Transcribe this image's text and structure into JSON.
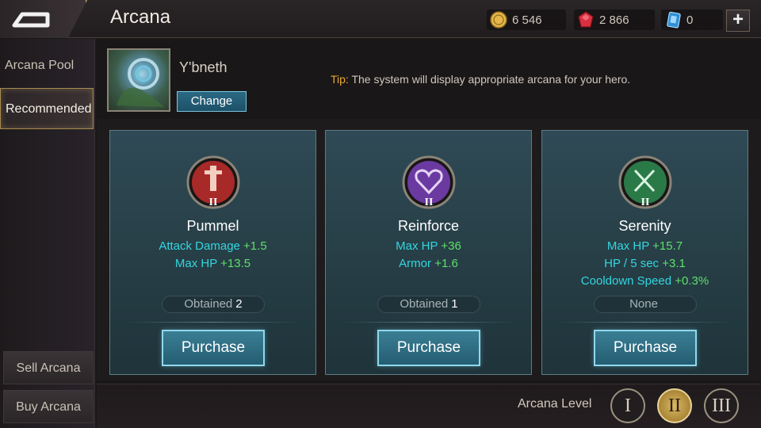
{
  "header": {
    "title": "Arcana",
    "resources": [
      {
        "icon": "gold-coin-icon",
        "value": "6 546"
      },
      {
        "icon": "ruby-gem-icon",
        "value": "2 866"
      },
      {
        "icon": "arcana-card-icon",
        "value": "0"
      }
    ],
    "plus_label": "+"
  },
  "sidebar": {
    "items": [
      {
        "label": "Arcana Pool"
      },
      {
        "label": "Recommended"
      }
    ],
    "sell_label": "Sell Arcana",
    "buy_label": "Buy Arcana"
  },
  "hero": {
    "name": "Y'bneth",
    "change_label": "Change",
    "tip_label": "Tip:",
    "tip_text": " The system will display appropriate arcana for your hero."
  },
  "cards": [
    {
      "name": "Pummel",
      "rank": "II",
      "color": "#b3322e",
      "stats": [
        {
          "label": "Attack Damage",
          "value": "+1.5"
        },
        {
          "label": "Max HP",
          "value": "+13.5"
        }
      ],
      "status_label": "Obtained",
      "status_count": "2",
      "purchase_label": "Purchase"
    },
    {
      "name": "Reinforce",
      "rank": "II",
      "color": "#7a3fb0",
      "stats": [
        {
          "label": "Max HP",
          "value": "+36"
        },
        {
          "label": "Armor",
          "value": "+1.6"
        }
      ],
      "status_label": "Obtained",
      "status_count": "1",
      "purchase_label": "Purchase"
    },
    {
      "name": "Serenity",
      "rank": "II",
      "color": "#2f8a52",
      "stats": [
        {
          "label": "Max HP",
          "value": "+15.7"
        },
        {
          "label": "HP / 5 sec",
          "value": "+3.1"
        },
        {
          "label": "Cooldown Speed",
          "value": "+0.3%"
        }
      ],
      "status_label": "None",
      "status_count": "",
      "purchase_label": "Purchase"
    }
  ],
  "level": {
    "label": "Arcana Level",
    "options": [
      "I",
      "II",
      "III"
    ],
    "selected": "II"
  }
}
